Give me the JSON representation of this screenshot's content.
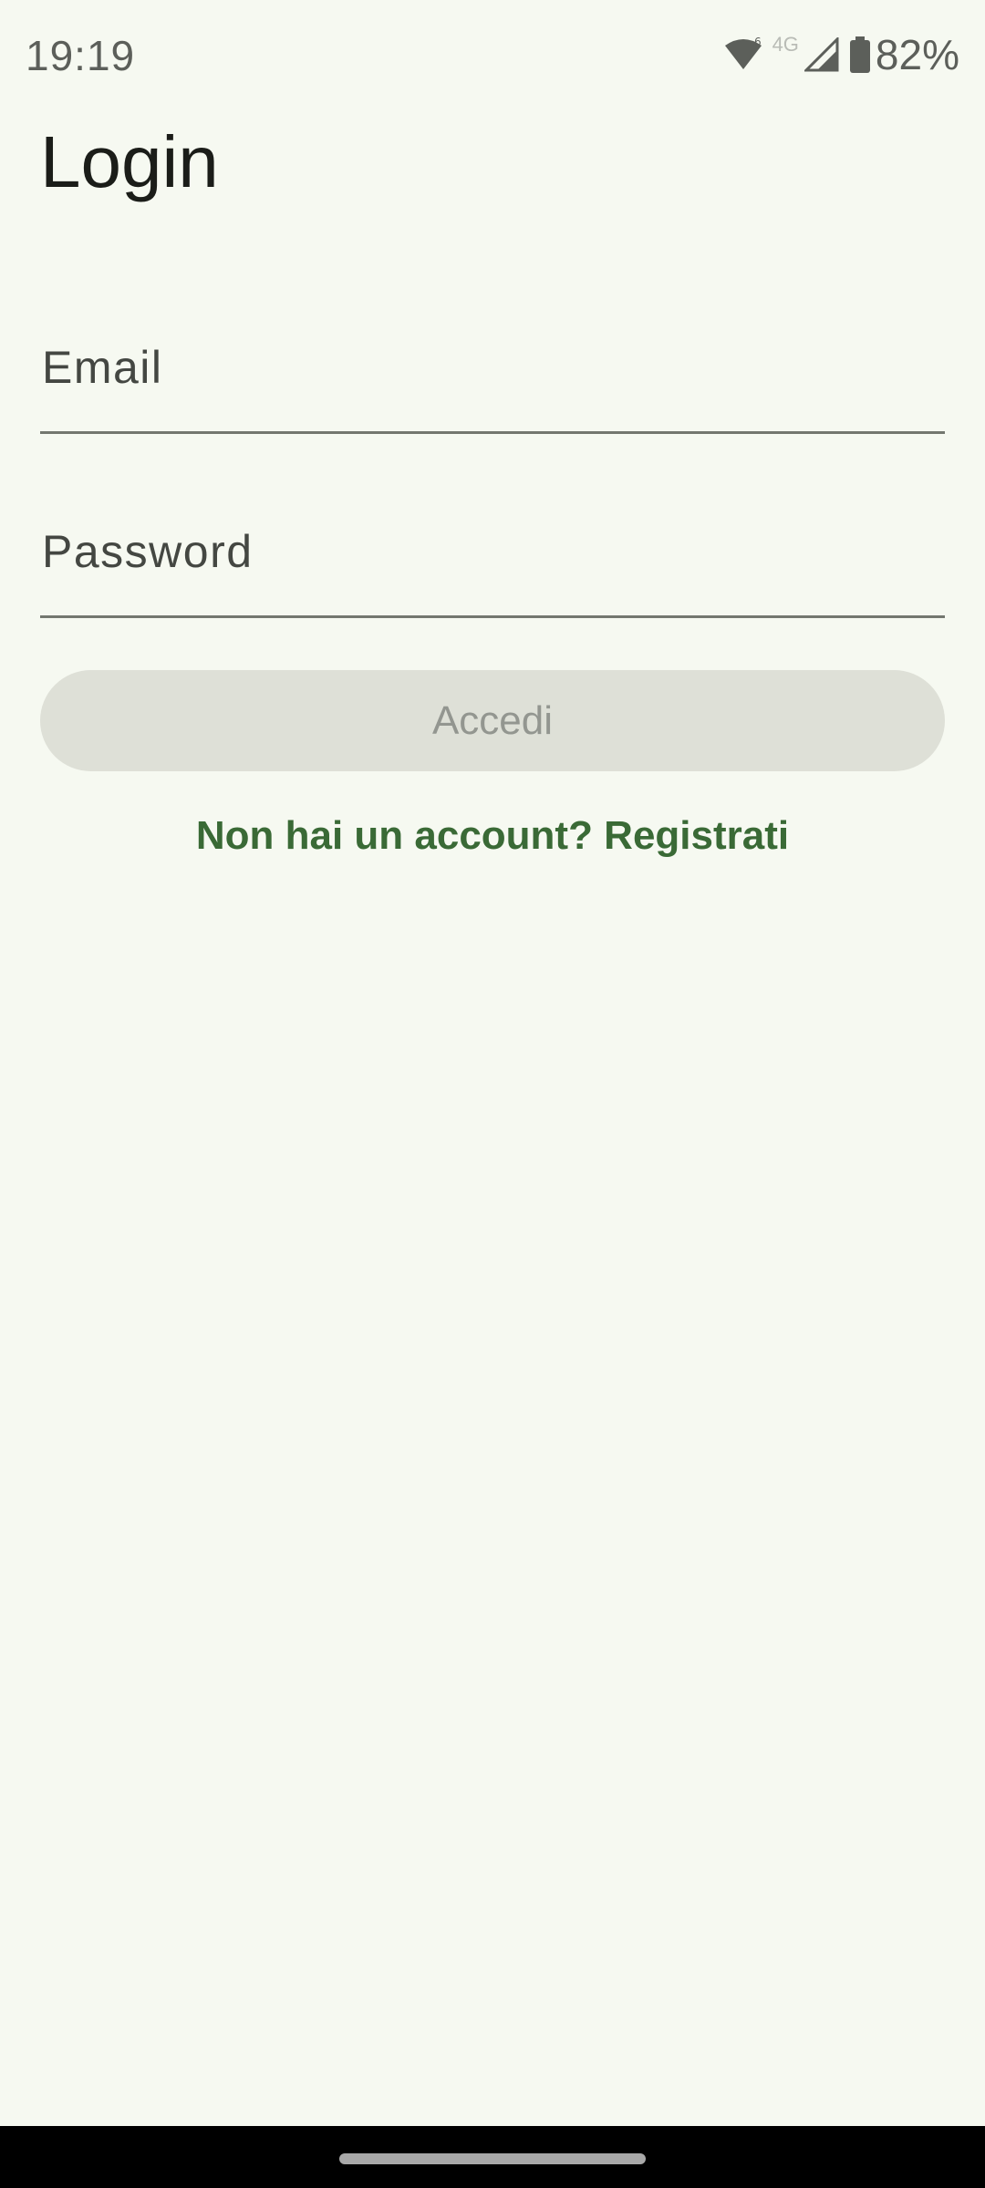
{
  "status_bar": {
    "time": "19:19",
    "network_label": "4G",
    "battery_percent": "82%",
    "icons": [
      "wifi-icon",
      "cell-signal-icon",
      "battery-icon"
    ],
    "icon_color": "#5c5f5a"
  },
  "header": {
    "title": "Login"
  },
  "form": {
    "email": {
      "placeholder": "Email",
      "value": ""
    },
    "password": {
      "placeholder": "Password",
      "value": ""
    },
    "submit_label": "Accedi",
    "submit_enabled": false,
    "register_link": "Non hai un account? Registrati"
  },
  "colors": {
    "background": "#f6f9f1",
    "accent": "#3a6a36",
    "disabled_button_bg": "#dee0d7",
    "disabled_button_text": "#939690"
  }
}
